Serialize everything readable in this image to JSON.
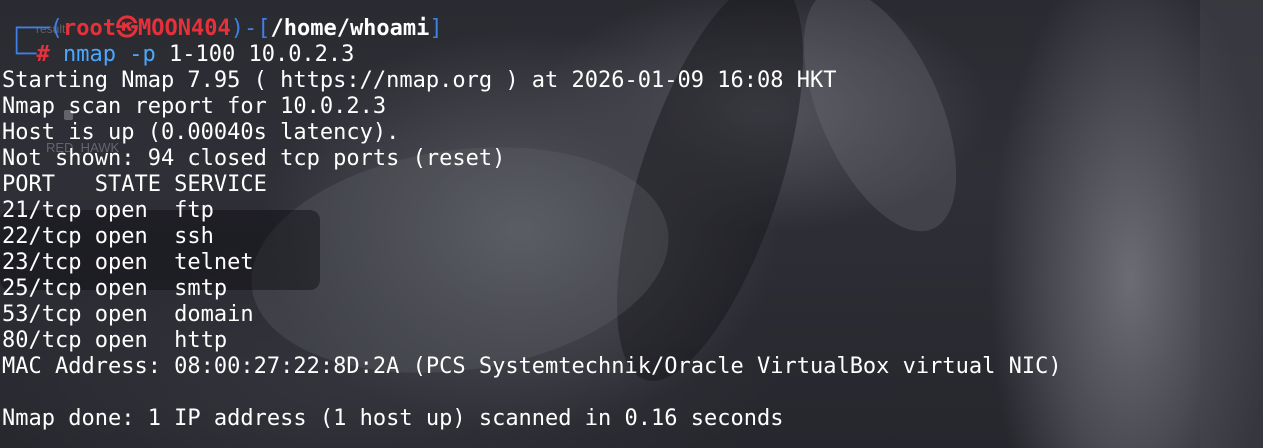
{
  "prompt": {
    "open_paren": "(",
    "user": "root",
    "at_symbol": "㉿",
    "host": "MOON404",
    "close_paren": ")",
    "dash": "-",
    "bracket_open": "[",
    "path": "/home/whoami",
    "bracket_close": "]",
    "corner_top": "┌──",
    "corner_bottom": "└─",
    "hash": "#"
  },
  "command": {
    "name": "nmap",
    "flag": "-p",
    "args": "1-100 10.0.2.3"
  },
  "output": [
    "Starting Nmap 7.95 ( https://nmap.org ) at 2026-01-09 16:08 HKT",
    "Nmap scan report for 10.0.2.3",
    "Host is up (0.00040s latency).",
    "Not shown: 94 closed tcp ports (reset)",
    "PORT   STATE SERVICE",
    "21/tcp open  ftp",
    "22/tcp open  ssh",
    "23/tcp open  telnet",
    "25/tcp open  smtp",
    "53/tcp open  domain",
    "80/tcp open  http",
    "MAC Address: 08:00:27:22:8D:2A (PCS Systemtechnik/Oracle VirtualBox virtual NIC)",
    "",
    "Nmap done: 1 IP address (1 host up) scanned in 0.16 seconds"
  ],
  "desktop_labels": {
    "result": "result",
    "red_hawk": "RED_HAWK"
  },
  "colors": {
    "prompt_frame": "#3f7fe8",
    "prompt_user": "#e8303a",
    "command": "#4aa7ff",
    "text": "#ffffff"
  },
  "icons": {
    "at_symbol": "kali-skull-at-icon",
    "lock": "lock-icon"
  }
}
